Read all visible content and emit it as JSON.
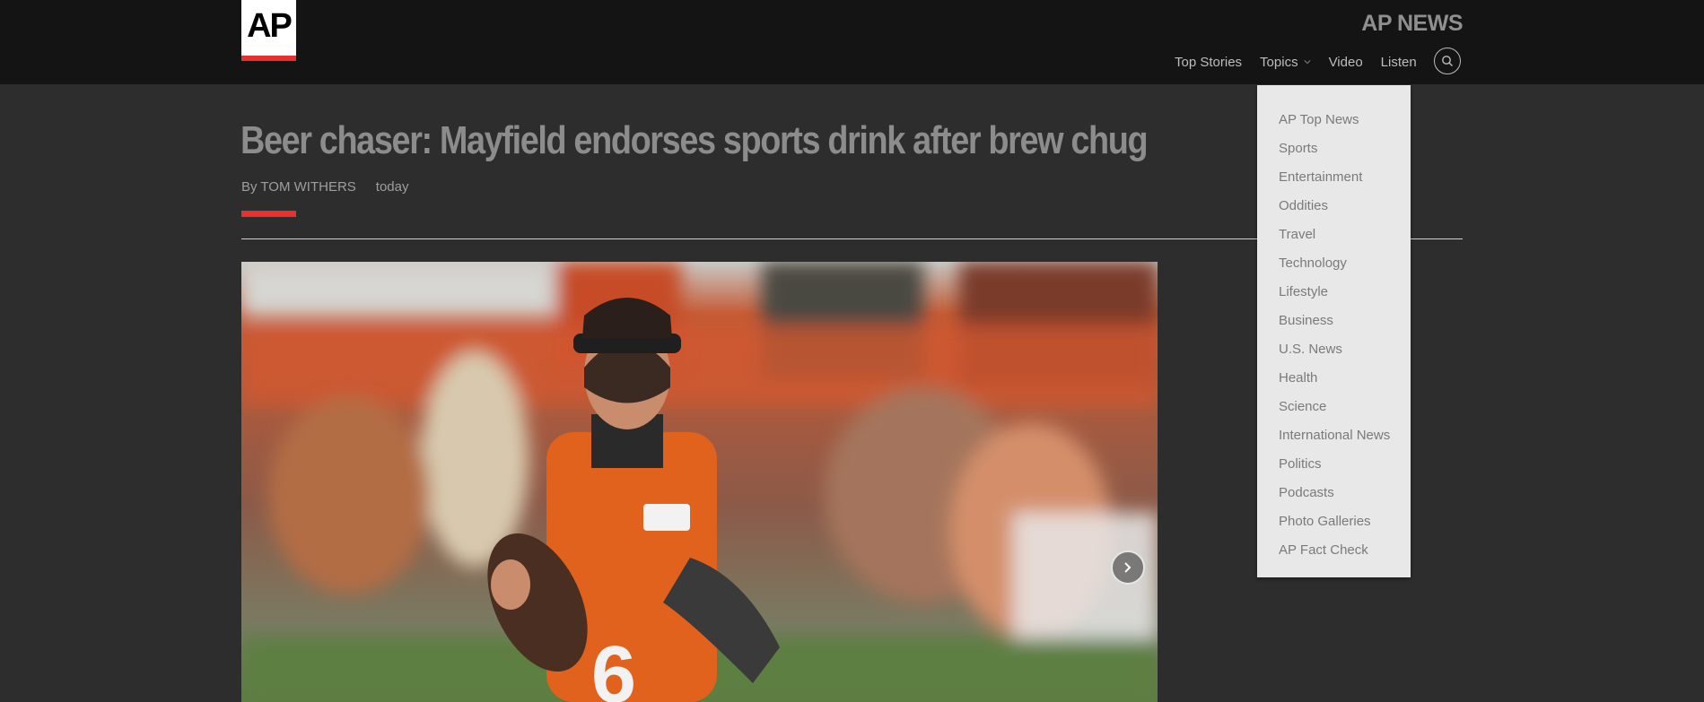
{
  "header": {
    "logo_text": "AP",
    "brand": "AP NEWS",
    "nav": [
      {
        "label": "Top Stories"
      },
      {
        "label": "Topics"
      },
      {
        "label": "Video"
      },
      {
        "label": "Listen"
      }
    ],
    "search_icon": "search-icon"
  },
  "topics_menu": [
    "AP Top News",
    "Sports",
    "Entertainment",
    "Oddities",
    "Travel",
    "Technology",
    "Lifestyle",
    "Business",
    "U.S. News",
    "Health",
    "Science",
    "International News",
    "Politics",
    "Podcasts",
    "Photo Galleries",
    "AP Fact Check"
  ],
  "article": {
    "headline": "Beer chaser: Mayfield endorses sports drink after brew chug",
    "author": "By TOM WITHERS",
    "date": "today"
  },
  "colors": {
    "header_bg": "#141414",
    "page_bg": "#2d2d2d",
    "accent_red": "#e8312f",
    "dropdown_bg": "#e8e8e8"
  }
}
